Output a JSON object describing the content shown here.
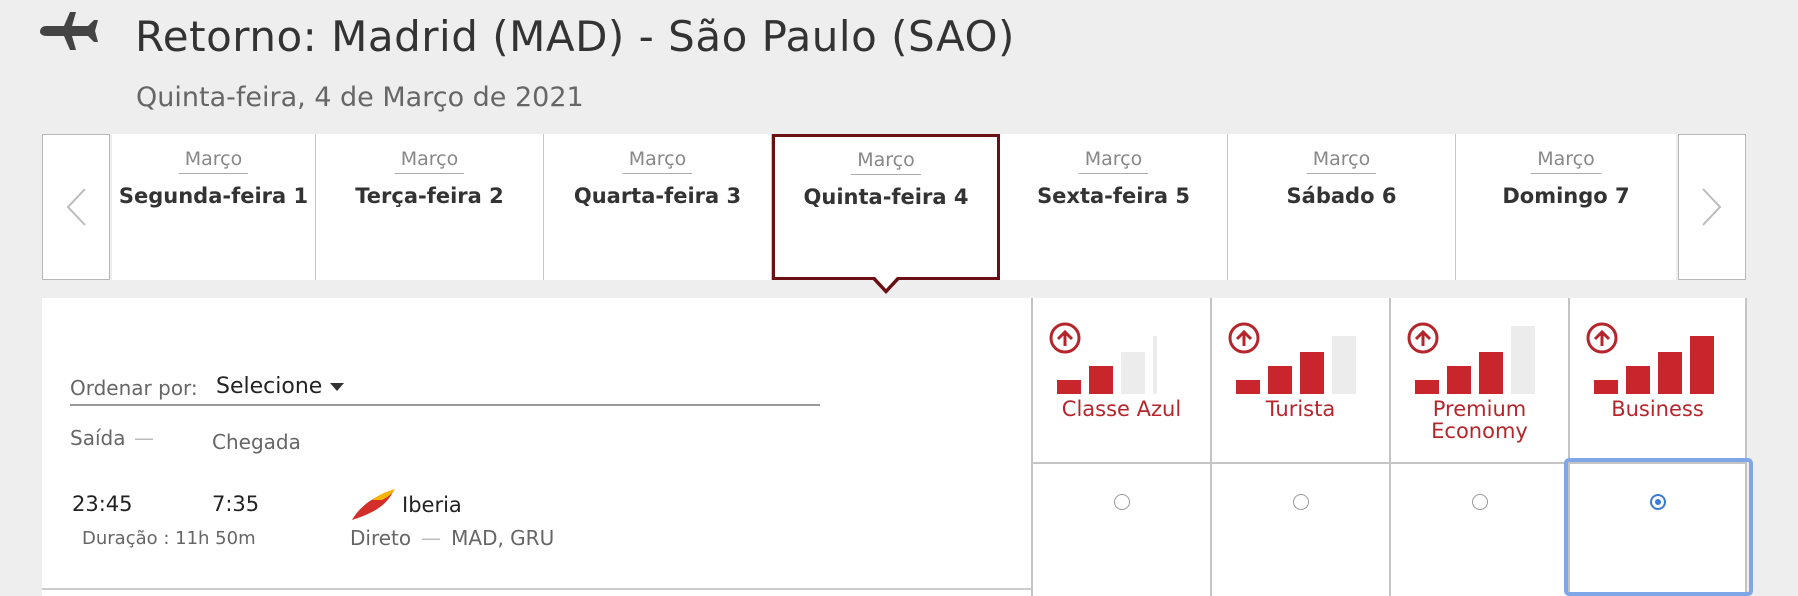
{
  "header": {
    "title": "Retorno: Madrid (MAD) - São Paulo (SAO)",
    "date": "Quinta-feira, 4 de Março de 2021"
  },
  "date_strip": {
    "prev_icon": "chevron-left-icon",
    "next_icon": "chevron-right-icon",
    "days": [
      {
        "month": "Março",
        "label": "Segunda-feira 1"
      },
      {
        "month": "Março",
        "label": "Terça-feira 2"
      },
      {
        "month": "Março",
        "label": "Quarta-feira 3"
      },
      {
        "month": "Março",
        "label": "Quinta-feira 4",
        "selected": true
      },
      {
        "month": "Março",
        "label": "Sexta-feira 5"
      },
      {
        "month": "Março",
        "label": "Sábado 6"
      },
      {
        "month": "Março",
        "label": "Domingo 7"
      }
    ]
  },
  "sort": {
    "label": "Ordenar por:",
    "value": "Selecione"
  },
  "columns": {
    "departure": "Saída",
    "departure_sep": "—",
    "arrival": "Chegada"
  },
  "flight": {
    "departure_time": "23:45",
    "arrival_time": "7:35",
    "duration": "Duração : 11h 50m",
    "airline": "Iberia",
    "stops": "Direto",
    "stops_sep": "—",
    "route": "MAD, GRU"
  },
  "fares": [
    {
      "name": "Classe Azul",
      "bar_levels": [
        1,
        2,
        0,
        0
      ],
      "selected": false
    },
    {
      "name": "Turista",
      "bar_levels": [
        1,
        2,
        3,
        0
      ],
      "selected": false
    },
    {
      "name": "Premium Economy",
      "bar_levels": [
        1,
        2,
        3,
        0
      ],
      "selected": false
    },
    {
      "name": "Business",
      "bar_levels": [
        1,
        2,
        3,
        4
      ],
      "selected": true
    }
  ],
  "colors": {
    "brand_red": "#b5262c",
    "selected_day_border": "#6b0f14",
    "radio_selected": "#3a7bd5"
  }
}
